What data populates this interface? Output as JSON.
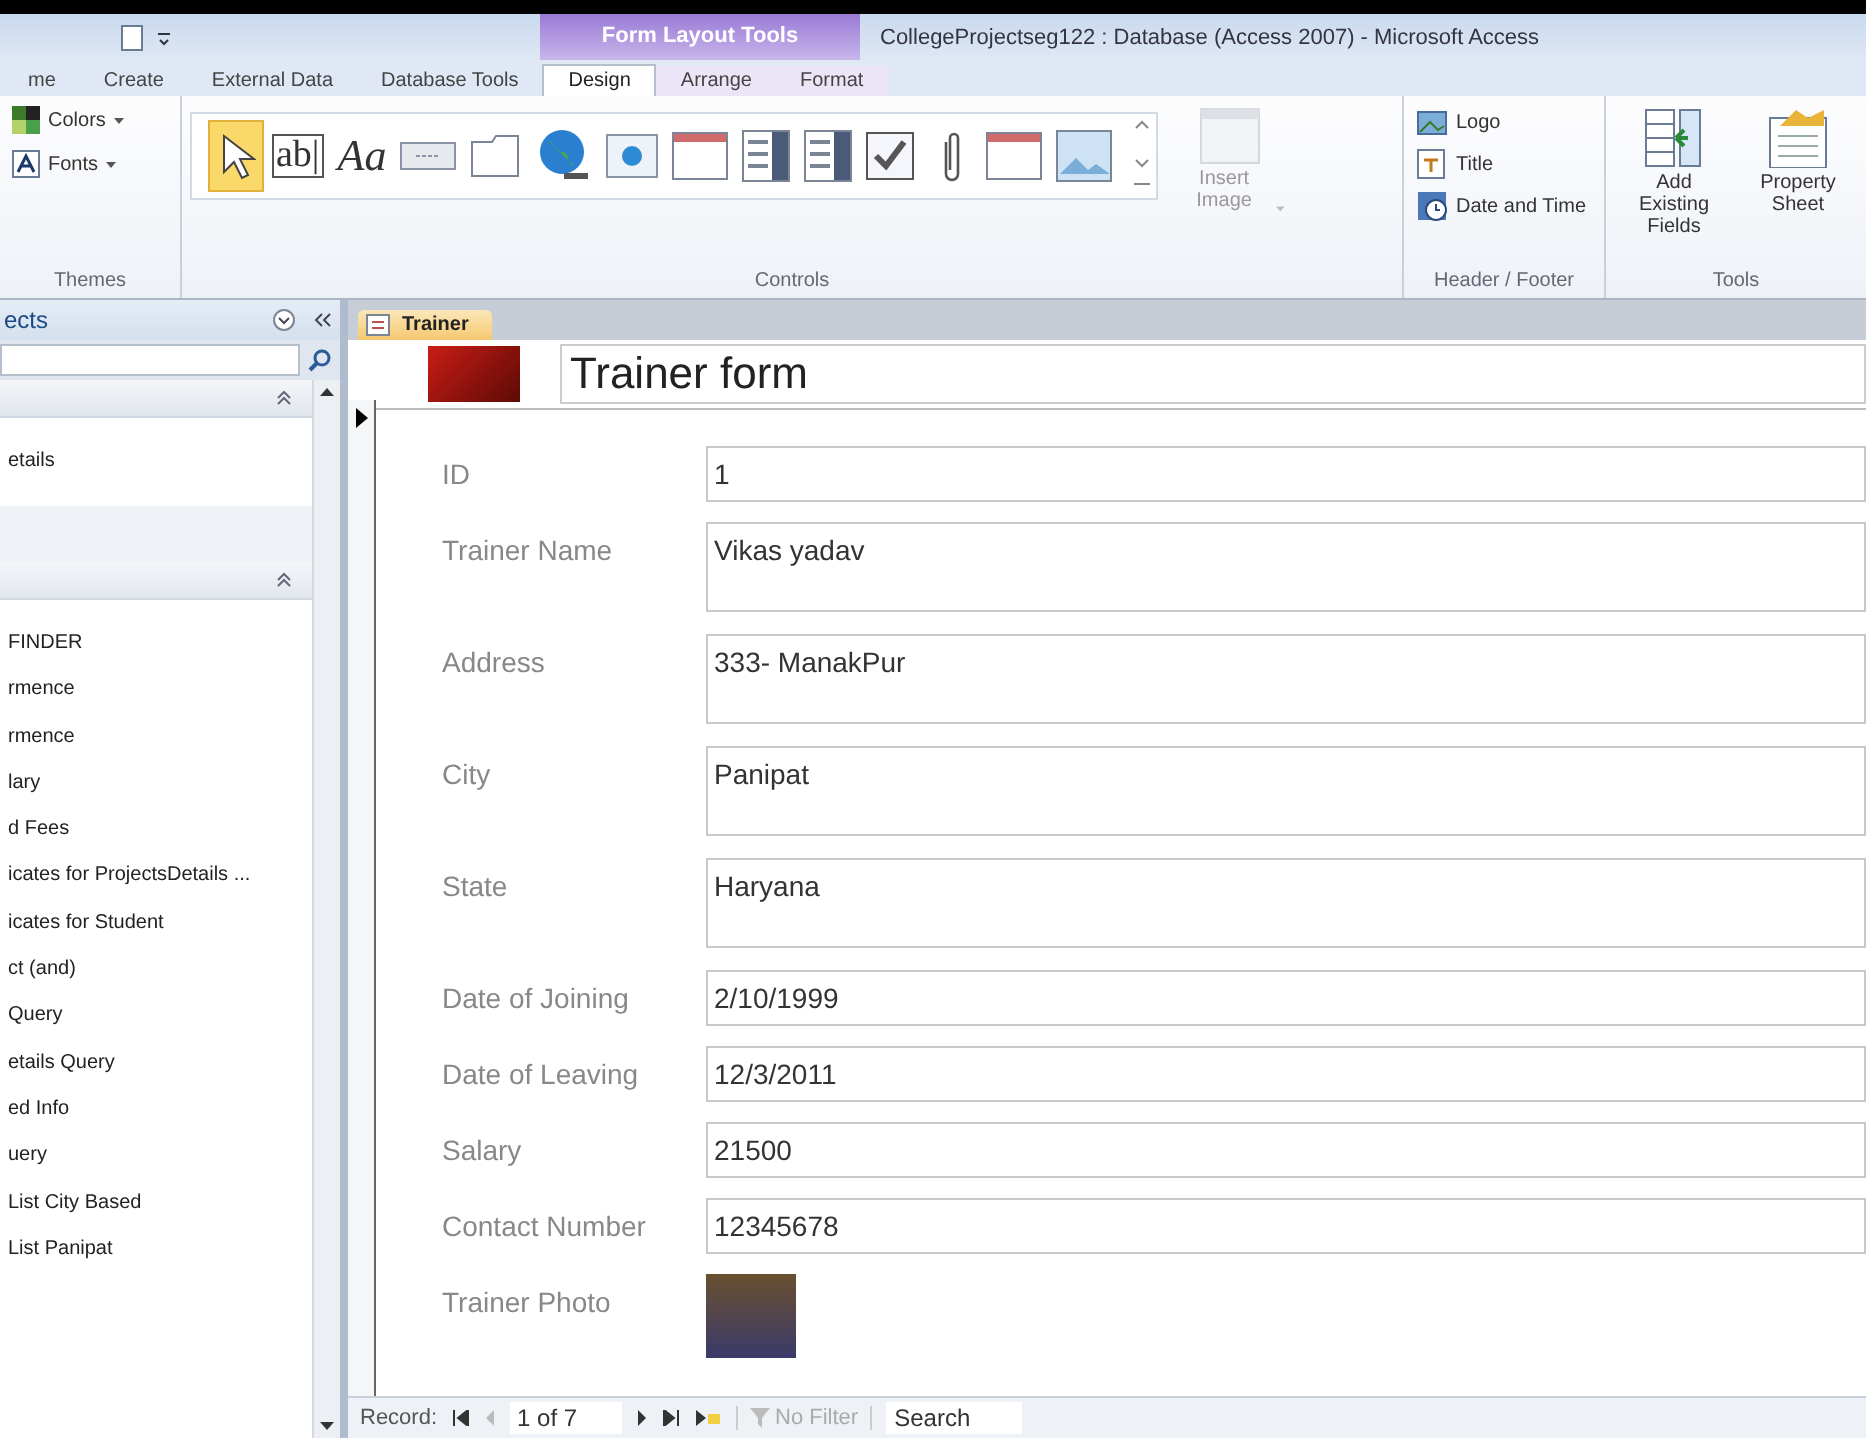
{
  "window": {
    "title": "CollegeProjectseg122 : Database (Access 2007)  -  Microsoft Access"
  },
  "ribbon": {
    "context_title": "Form Layout Tools",
    "tabs": [
      {
        "label": "me",
        "selected": false
      },
      {
        "label": "Create",
        "selected": false
      },
      {
        "label": "External Data",
        "selected": false
      },
      {
        "label": "Database Tools",
        "selected": false
      },
      {
        "label": "Design",
        "selected": true
      },
      {
        "label": "Arrange",
        "selected": false
      },
      {
        "label": "Format",
        "selected": false
      }
    ],
    "themes": {
      "items": [
        "Colors",
        "Fonts"
      ],
      "label": "Themes"
    },
    "controls": {
      "label": "Controls",
      "items": [
        {
          "kind": "pointer",
          "selected": true
        },
        {
          "kind": "glyph",
          "text": "ab|",
          "selected": false
        },
        {
          "kind": "glyph",
          "text": "Aa",
          "selected": false
        },
        {
          "kind": "button",
          "selected": false
        },
        {
          "kind": "tab",
          "selected": false
        },
        {
          "kind": "globe",
          "selected": false
        },
        {
          "kind": "nav",
          "selected": false
        },
        {
          "kind": "frame",
          "selected": false
        },
        {
          "kind": "list",
          "selected": false
        },
        {
          "kind": "list",
          "selected": false
        },
        {
          "kind": "check",
          "selected": false
        },
        {
          "kind": "clip",
          "selected": false
        },
        {
          "kind": "frame",
          "selected": false
        },
        {
          "kind": "image",
          "selected": false
        }
      ]
    },
    "insert_image": {
      "label": "Insert Image",
      "disabled": true
    },
    "header_footer": {
      "items": [
        {
          "kind": "logo",
          "label": "Logo"
        },
        {
          "kind": "title",
          "label": "Title"
        },
        {
          "kind": "date",
          "label": "Date and Time"
        }
      ],
      "label": "Header / Footer"
    },
    "tools": {
      "items": [
        {
          "kind": "fields",
          "label": "Add Existing Fields"
        },
        {
          "kind": "sheet",
          "label": "Property Sheet"
        }
      ],
      "label": "Tools"
    }
  },
  "nav_pane": {
    "title": "ects",
    "sections": [
      {
        "items": [
          "etails"
        ]
      },
      {
        "items": [
          "FINDER",
          "rmence",
          "rmence",
          "lary",
          "d Fees",
          "icates for ProjectsDetails ...",
          "icates for Student",
          "ct (and)",
          "Query",
          "etails Query",
          "ed Info",
          "uery",
          "List City Based",
          "List Panipat"
        ]
      }
    ]
  },
  "document_tab": {
    "label": "Trainer",
    "selected": true
  },
  "form": {
    "title": "Trainer form",
    "fields": [
      {
        "label": "ID",
        "value": "1",
        "kind": "short"
      },
      {
        "label": "Trainer Name",
        "value": "Vikas yadav",
        "kind": "tall"
      },
      {
        "label": "Address",
        "value": "333- ManakPur",
        "kind": "tall"
      },
      {
        "label": "City",
        "value": "Panipat",
        "kind": "tall"
      },
      {
        "label": "State",
        "value": "Haryana",
        "kind": "tall"
      },
      {
        "label": "Date of Joining",
        "value": "2/10/1999",
        "kind": "short"
      },
      {
        "label": "Date of Leaving",
        "value": "12/3/2011",
        "kind": "short"
      },
      {
        "label": "Salary",
        "value": "21500",
        "kind": "short"
      },
      {
        "label": "Contact Number",
        "value": "12345678",
        "kind": "short"
      },
      {
        "label": "Trainer Photo",
        "kind": "photo"
      }
    ]
  },
  "record_bar": {
    "label": "Record:",
    "position": "1 of 7",
    "filter": "No Filter",
    "search": "Search"
  }
}
